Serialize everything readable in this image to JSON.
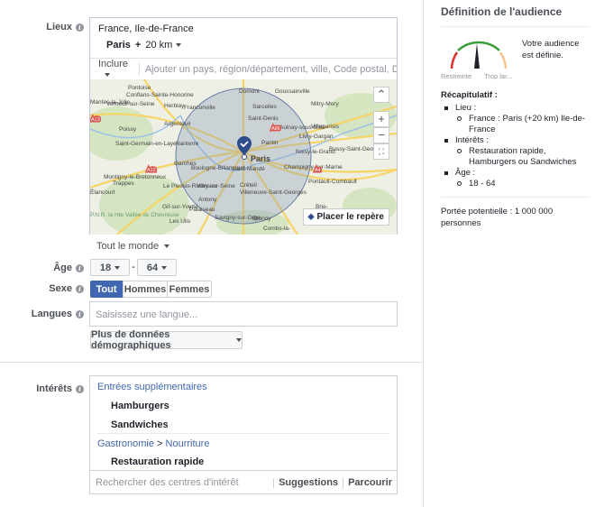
{
  "location": {
    "label": "Lieux",
    "region": "France, Ile-de-France",
    "city": "Paris",
    "plus": "+",
    "radius": "20 km",
    "include_label": "Inclure",
    "placeholder": "Ajouter un pays, région/département, ville, Code postal, DMA (Zone",
    "map": {
      "labels": [
        "Pontoise",
        "Conflans-Sainte-Honorine",
        "Mantes-la-Jolie",
        "Verneuil-sur-Seine",
        "Herblay",
        "Franconville",
        "Domont",
        "Goussainville",
        "Sarcelles",
        "Mitry-Mory",
        "Argenteuil",
        "Saint-Denis",
        "Aulnay-sous-Bois",
        "Villeparisis",
        "Poissy",
        "Saint-Germain-en-Laye",
        "Nanterre",
        "Pantin",
        "Livry-Gargan",
        "Paris",
        "Noisy-le-Grand",
        "Bussy-Saint-Georges",
        "Garches",
        "Boulogne-Billancourt",
        "Saint-Mandé",
        "Champigny-sur-Marne",
        "Montigny-le-Bretonneux",
        "Trappes",
        "Pontault-Combault",
        "Le Plessis-Robinson",
        "Vitry-sur-Seine",
        "Créteil",
        "Villeneuve-Saint-Georges",
        "Élancourt",
        "Antony",
        "Gif-sur-Yvette",
        "Palaiseau",
        "Brunoy",
        "Brie-",
        "P.N.R. la Hte Vallée de Chevreuse",
        "Les Ulis",
        "Savigny-sur-Orge",
        "Combs-la-"
      ],
      "roads": [
        "A13",
        "A86",
        "A12",
        "A4"
      ],
      "place_pin_label": "Placer le repère",
      "zoom_in": "+",
      "zoom_out": "−"
    },
    "audience_scope": "Tout le monde"
  },
  "age": {
    "label": "Âge",
    "min": "18",
    "max": "64",
    "dash": "-"
  },
  "gender": {
    "label": "Sexe",
    "options": [
      "Tout",
      "Hommes",
      "Femmes"
    ],
    "selected": "Tout"
  },
  "languages": {
    "label": "Langues",
    "placeholder": "Saisissez une langue..."
  },
  "more_demographics": "Plus de données démographiques",
  "interests": {
    "label": "Intérêts",
    "groups": [
      {
        "category": "Entrées supplémentaires",
        "items": [
          "Hamburgers",
          "Sandwiches"
        ]
      },
      {
        "category_parts": [
          "Gastronomie",
          " > ",
          "Nourriture"
        ],
        "items": [
          "Restauration rapide"
        ]
      }
    ],
    "search_placeholder": "Rechercher des centres d'intérêt",
    "suggestions": "Suggestions",
    "browse": "Parcourir"
  },
  "audience": {
    "title": "Définition de l'audience",
    "gauge_low": "Restreinte",
    "gauge_high": "Trop lar...",
    "gauge_level": 0.5,
    "status": "Votre audience est définie.",
    "summary_title": "Récapitulatif :",
    "summary": [
      {
        "label": "Lieu :",
        "values": [
          "France : Paris (+20 km) Ile-de-France"
        ]
      },
      {
        "label": "Intérêts :",
        "values": [
          "Restauration rapide, Hamburgers ou Sandwiches"
        ]
      },
      {
        "label": "Âge :",
        "values": [
          "18 - 64"
        ]
      }
    ],
    "reach": "Portée potentielle : 1 000 000 personnes"
  },
  "colors": {
    "accent": "#4267b2",
    "link": "#365899",
    "gauge_green": "#3a9d3a",
    "gauge_red": "#d9322a",
    "gauge_orange": "#f5c28c"
  }
}
